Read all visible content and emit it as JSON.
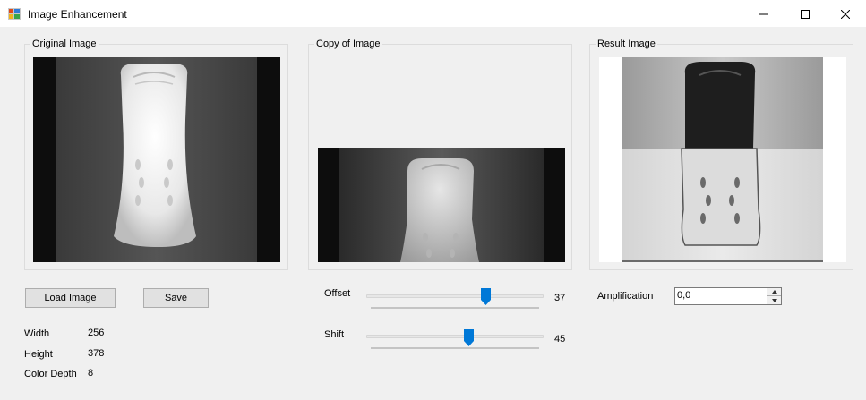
{
  "window": {
    "title": "Image Enhancement",
    "minimize_glyph": "—",
    "maximize_glyph": "☐",
    "close_glyph": "✕"
  },
  "groups": {
    "original": "Original Image",
    "copy": "Copy of Image",
    "result": "Result Image"
  },
  "buttons": {
    "load": "Load Image",
    "save": "Save"
  },
  "info": {
    "width_label": "Width",
    "width_value": "256",
    "height_label": "Height",
    "height_value": "378",
    "depth_label": "Color Depth",
    "depth_value": "8"
  },
  "sliders": {
    "offset_label": "Offset",
    "offset_value": "37",
    "shift_label": "Shift",
    "shift_value": "45"
  },
  "amplification": {
    "label": "Amplification",
    "value": "0,0"
  },
  "colors": {
    "accent": "#0078d7"
  }
}
